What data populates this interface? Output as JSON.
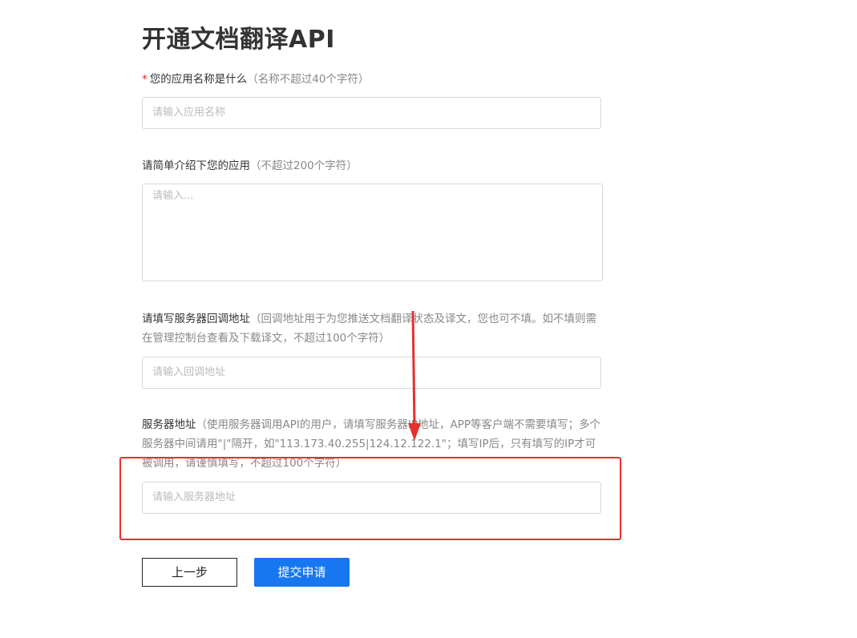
{
  "page": {
    "title": "开通文档翻译API"
  },
  "form": {
    "app_name": {
      "required_mark": "*",
      "label": "您的应用名称是什么",
      "hint": "（名称不超过40个字符）",
      "placeholder": "请输入应用名称"
    },
    "app_desc": {
      "label": "请简单介绍下您的应用",
      "hint": "（不超过200个字符）",
      "placeholder": "请输入..."
    },
    "callback": {
      "label": "请填写服务器回调地址",
      "hint": "（回调地址用于为您推送文档翻译状态及译文，您也可不填。如不填则需在管理控制台查看及下载译文，不超过100个字符）",
      "placeholder": "请输入回调地址"
    },
    "server": {
      "label": "服务器地址",
      "hint": "（使用服务器调用API的用户，请填写服务器IP地址，APP等客户端不需要填写；多个服务器中间请用\"|\"隔开，如\"113.173.40.255|124.12.122.1\"；填写IP后，只有填写的IP才可被调用，请谨慎填写，不超过100个字符）",
      "placeholder": "请输入服务器地址"
    }
  },
  "buttons": {
    "back_label": "上一步",
    "submit_label": "提交申请"
  },
  "annotation": {
    "highlight_color": "#e53030",
    "arrow_color": "#e53030"
  }
}
